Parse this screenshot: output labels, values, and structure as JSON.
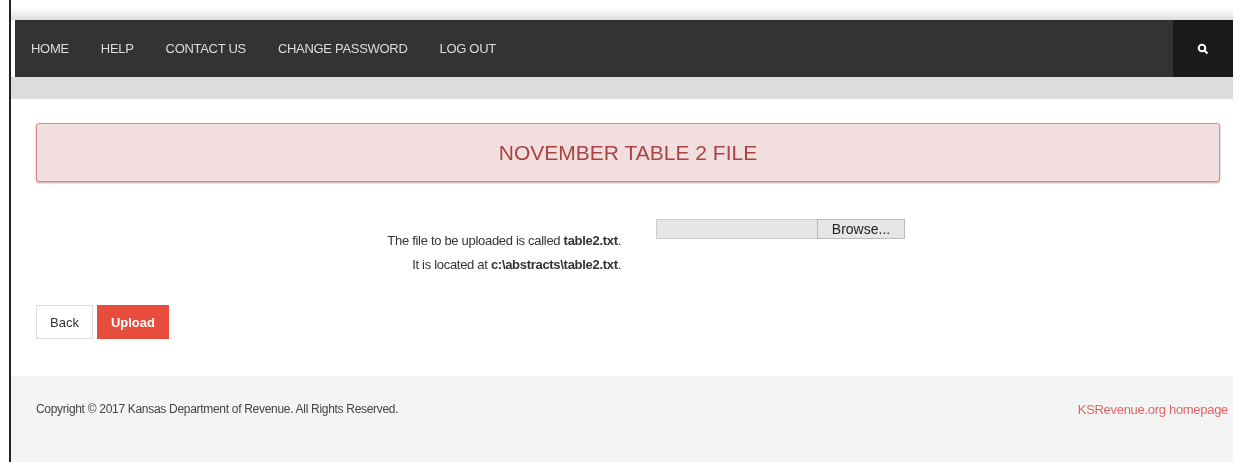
{
  "nav": {
    "items": [
      {
        "label": "HOME"
      },
      {
        "label": "HELP"
      },
      {
        "label": "CONTACT US"
      },
      {
        "label": "CHANGE PASSWORD"
      },
      {
        "label": "LOG OUT"
      }
    ]
  },
  "alert": {
    "title": "NOVEMBER TABLE 2 FILE"
  },
  "upload": {
    "lines": [
      "The file to be uploaded is called **table2.txt**.",
      "It is located at **c:\\abstracts\\table2.txt**."
    ],
    "browse_button": "Browse..."
  },
  "buttons": [
    {
      "label": "Back",
      "kind": "default"
    },
    {
      "label": "Upload",
      "kind": "primary"
    }
  ],
  "footer": {
    "copyright": "Copyright © 2017 Kansas Department of Revenue. All Rights Reserved.",
    "link": "KSRevenue.org homepage"
  }
}
